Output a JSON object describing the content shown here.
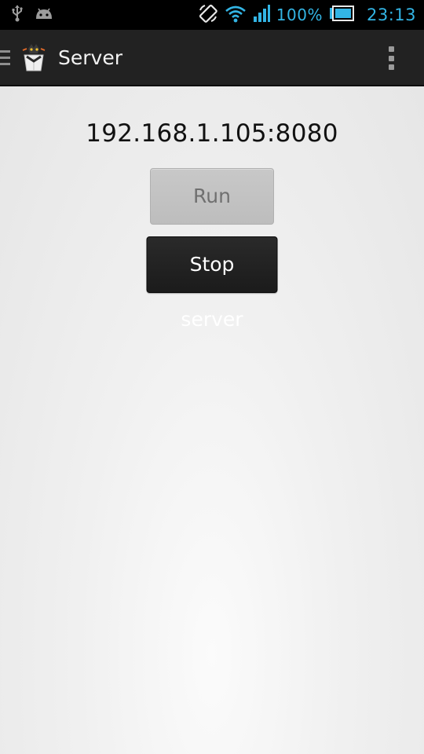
{
  "status_bar": {
    "left_icons": [
      "usb-icon",
      "android-debug-icon"
    ],
    "right_icons": [
      "screen-rotate-icon",
      "wifi-icon",
      "signal-icon",
      "battery-icon"
    ],
    "battery_percent": "100%",
    "time": "23:13",
    "accent_color": "#33b5e5"
  },
  "action_bar": {
    "title": "Server",
    "icons": [
      "drawer-icon",
      "app-icon",
      "overflow-menu-icon"
    ]
  },
  "main": {
    "address": "192.168.1.105:8080",
    "run_button": {
      "label": "Run server",
      "enabled": false
    },
    "stop_button": {
      "label": "Stop server",
      "enabled": true
    }
  }
}
